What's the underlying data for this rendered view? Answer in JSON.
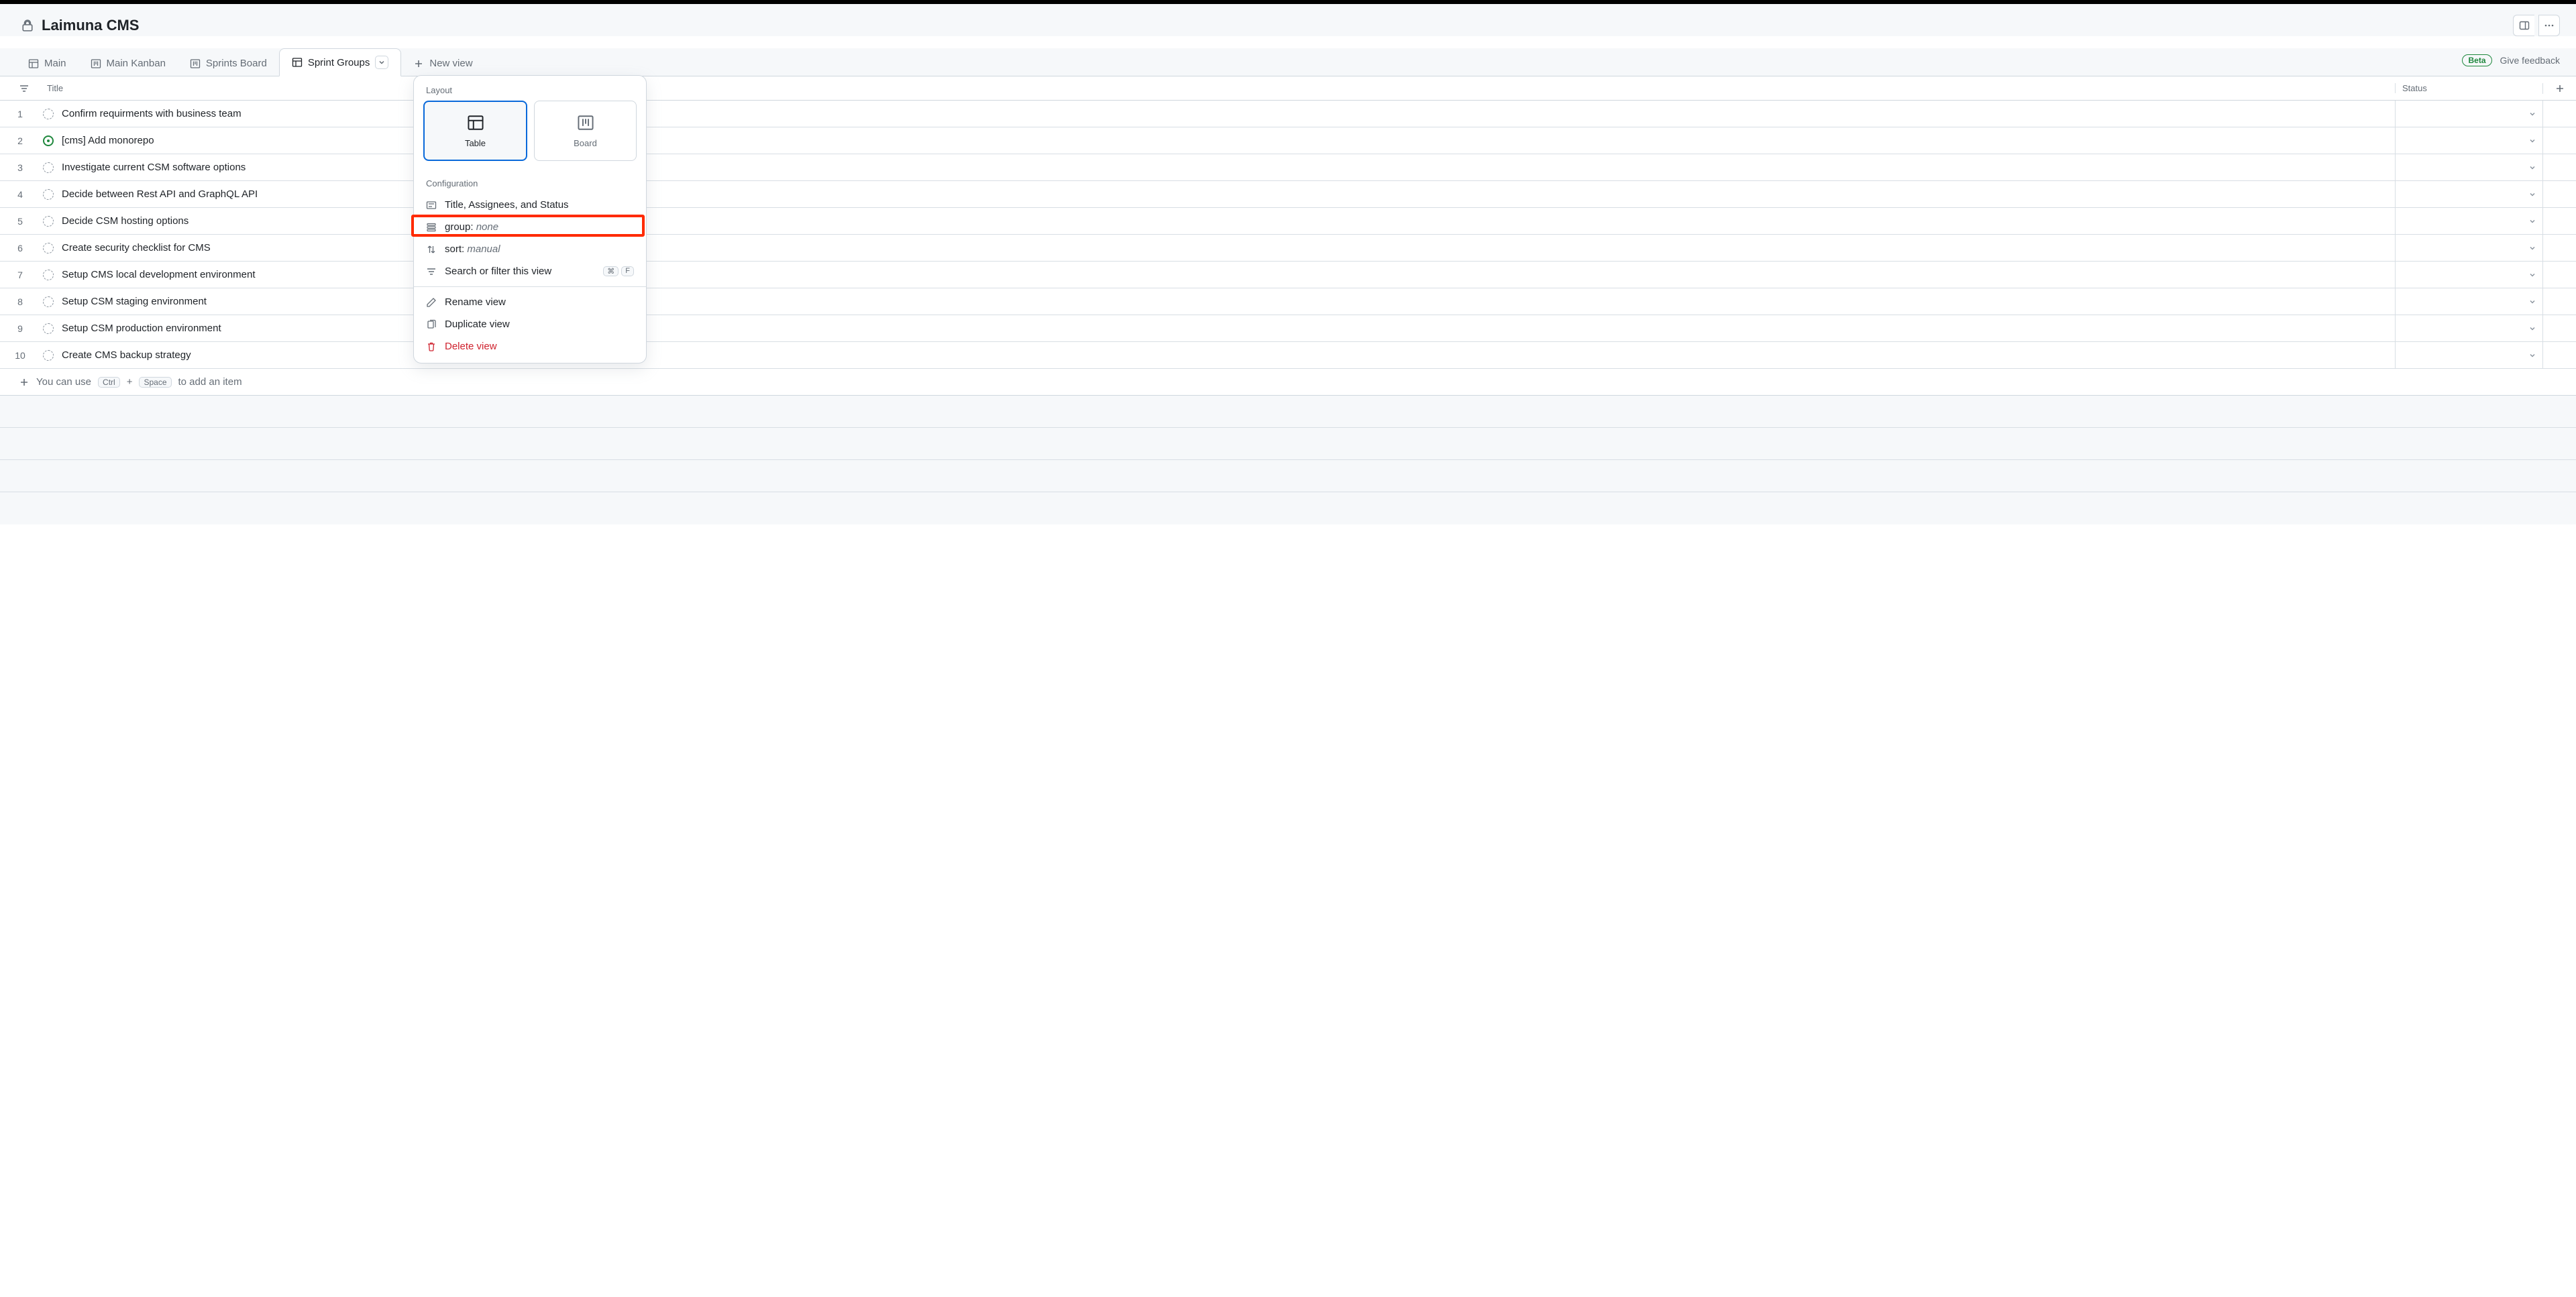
{
  "project_title": "Laimuna CMS",
  "tabs": [
    {
      "label": "Main",
      "icon": "table",
      "active": false
    },
    {
      "label": "Main Kanban",
      "icon": "board",
      "active": false
    },
    {
      "label": "Sprints Board",
      "icon": "board",
      "active": false
    },
    {
      "label": "Sprint Groups",
      "icon": "table",
      "active": true
    },
    {
      "label": "New view",
      "icon": "plus",
      "active": false,
      "new": true
    }
  ],
  "beta_badge": "Beta",
  "give_feedback": "Give feedback",
  "columns": {
    "title": "Title",
    "status": "Status"
  },
  "rows": [
    {
      "n": 1,
      "state": "draft",
      "title": "Confirm requirments with business team"
    },
    {
      "n": 2,
      "state": "open",
      "title": "[cms] Add monorepo"
    },
    {
      "n": 3,
      "state": "draft",
      "title": "Investigate current CSM software options"
    },
    {
      "n": 4,
      "state": "draft",
      "title": "Decide between Rest API and GraphQL API"
    },
    {
      "n": 5,
      "state": "draft",
      "title": "Decide CSM hosting options"
    },
    {
      "n": 6,
      "state": "draft",
      "title": "Create security checklist for CMS"
    },
    {
      "n": 7,
      "state": "draft",
      "title": "Setup CMS local development environment"
    },
    {
      "n": 8,
      "state": "draft",
      "title": "Setup CSM staging environment"
    },
    {
      "n": 9,
      "state": "draft",
      "title": "Setup CSM production environment"
    },
    {
      "n": 10,
      "state": "draft",
      "title": "Create CMS backup strategy"
    }
  ],
  "add_item": {
    "prefix": "You can use",
    "kbd1": "Ctrl",
    "plus": "+",
    "kbd2": "Space",
    "suffix": "to add an item"
  },
  "popover": {
    "layout_label": "Layout",
    "layout_table": "Table",
    "layout_board": "Board",
    "config_label": "Configuration",
    "fields": "Title, Assignees, and Status",
    "group_label": "group:",
    "group_value": "none",
    "sort_label": "sort:",
    "sort_value": "manual",
    "search": "Search or filter this view",
    "search_kbd1": "⌘",
    "search_kbd2": "F",
    "rename": "Rename view",
    "duplicate": "Duplicate view",
    "delete": "Delete view"
  }
}
